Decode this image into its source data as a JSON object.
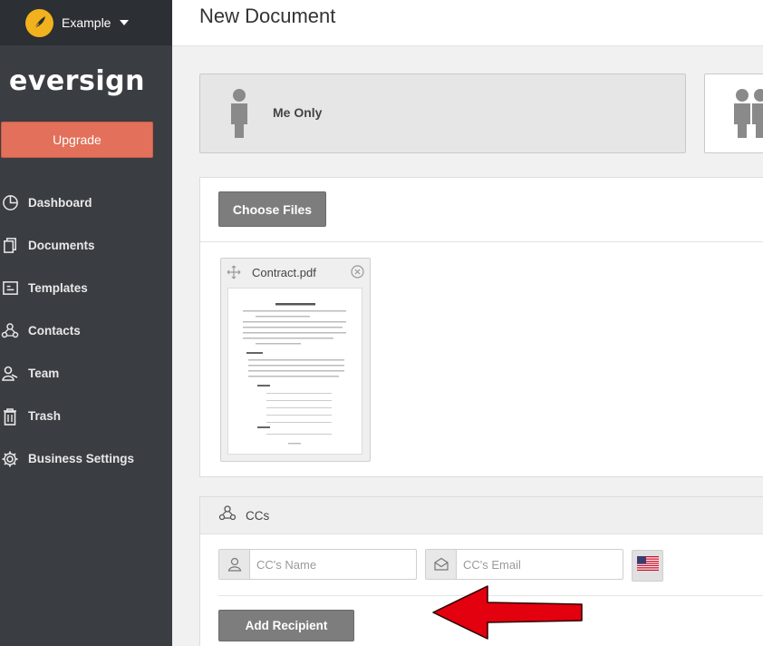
{
  "account": {
    "name": "Example",
    "logo_icon": "quill-icon"
  },
  "brand": {
    "name": "eversign"
  },
  "sidebar": {
    "upgrade_label": "Upgrade",
    "items": [
      {
        "label": "Dashboard",
        "icon": "pie-chart-icon"
      },
      {
        "label": "Documents",
        "icon": "documents-icon"
      },
      {
        "label": "Templates",
        "icon": "templates-icon"
      },
      {
        "label": "Contacts",
        "icon": "contacts-icon"
      },
      {
        "label": "Team",
        "icon": "team-icon"
      },
      {
        "label": "Trash",
        "icon": "trash-icon"
      },
      {
        "label": "Business Settings",
        "icon": "gear-icon"
      }
    ]
  },
  "header": {
    "title": "New Document"
  },
  "signers": {
    "me_only_label": "Me Only"
  },
  "files": {
    "choose_label": "Choose Files",
    "items": [
      {
        "name": "Contract.pdf"
      }
    ]
  },
  "cc": {
    "header_label": "CCs",
    "name_placeholder": "CC's Name",
    "email_placeholder": "CC's Email",
    "add_label": "Add Recipient"
  },
  "colors": {
    "sidebar_bg": "#3a3d42",
    "upgrade": "#e3705a",
    "logo": "#f2b21d",
    "button_gray": "#7d7d7d",
    "annotation_arrow": "#e3000f"
  }
}
